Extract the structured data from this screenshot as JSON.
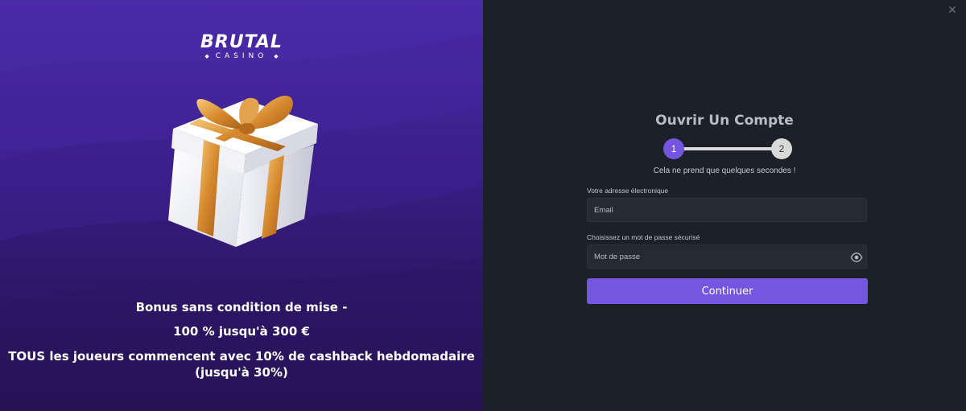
{
  "promo": {
    "logo_main": "BRUTAL",
    "logo_sub": "CASINO",
    "lines": [
      "Bonus sans condition de mise -",
      "100 % jusqu'à 300 €",
      "TOUS les joueurs commencent avec 10% de cashback hebdomadaire (jusqu'à 30%)"
    ],
    "icons": {
      "gift": "gift-box-illustration"
    }
  },
  "form": {
    "close_label": "✕",
    "title": "Ouvrir Un Compte",
    "steps": [
      "1",
      "2"
    ],
    "current_step": 1,
    "subtitle": "Cela ne prend que quelques secondes !",
    "email_label": "Votre adresse électronique",
    "email_placeholder": "Email",
    "password_label": "Choisissez un mot de passe sécurisé",
    "password_placeholder": "Mot de passe",
    "submit_label": "Continuer",
    "icons": {
      "close": "close-icon",
      "reveal": "eye-icon"
    }
  },
  "colors": {
    "accent": "#7456e0",
    "panel_bg": "#1c2029",
    "promo_top": "#4a2aa8",
    "promo_bottom": "#26124f"
  }
}
